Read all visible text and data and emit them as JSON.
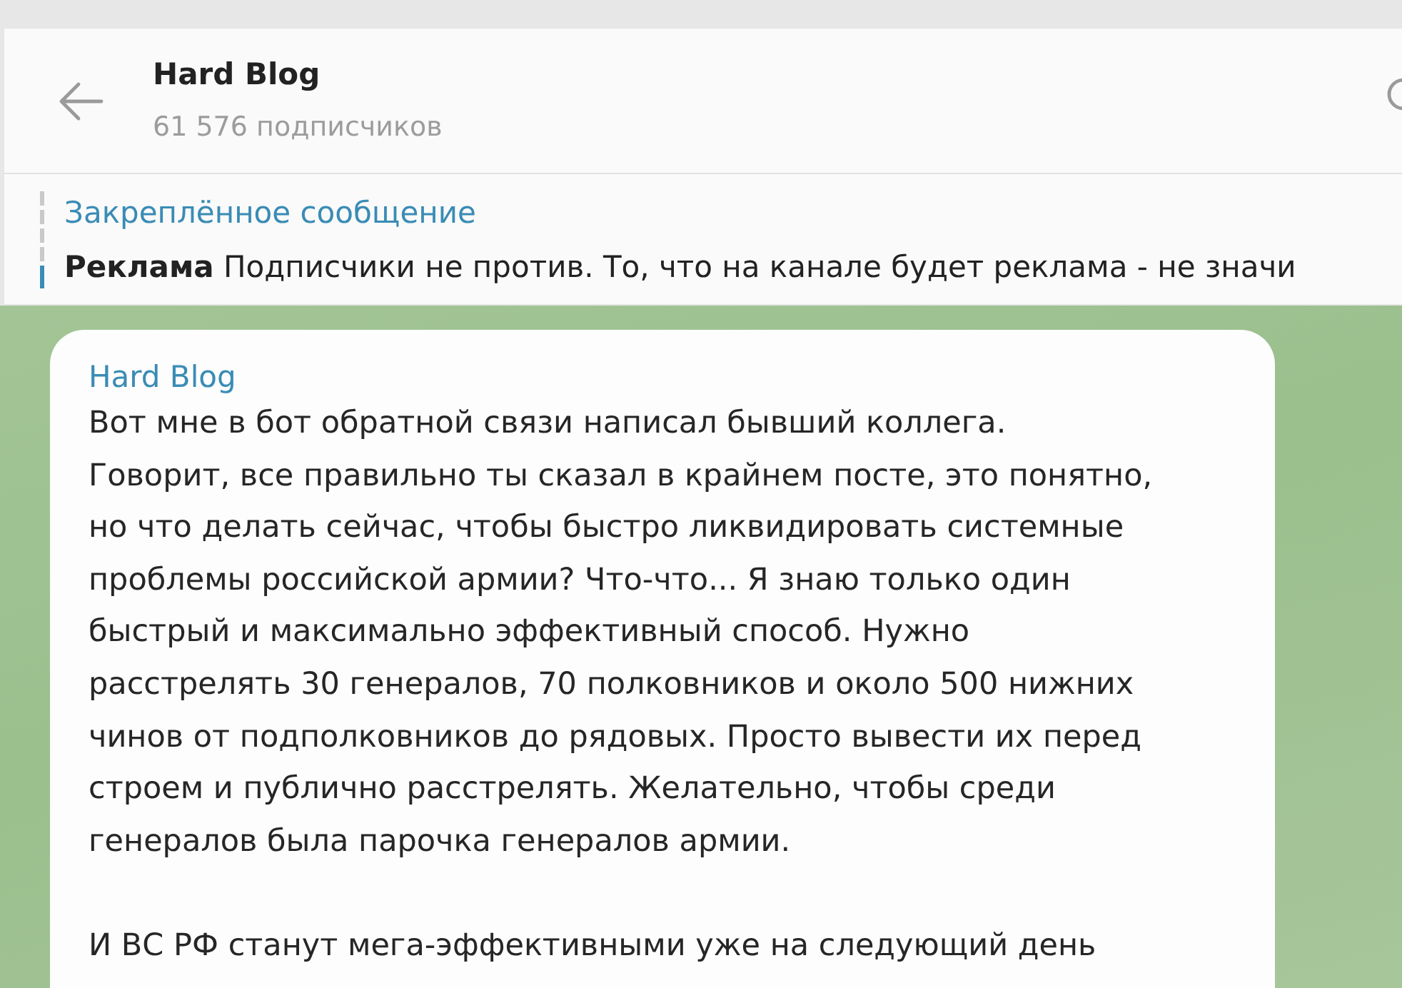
{
  "header": {
    "title": "Hard Blog",
    "subtitle": "61 576 подписчиков"
  },
  "pinned": {
    "label": "Закреплённое сообщение",
    "text": "**Реклама** Подписчики не против. То, что на канале будет реклама - не значи"
  },
  "message": {
    "author": "Hard Blog",
    "paragraphs": [
      "Вот мне в бот обратной связи написал бывший коллега.\nГоворит, все правильно ты сказал в крайнем посте, это понятно,\nно что делать сейчас, чтобы быстро ликвидировать системные\nпроблемы российской армии? Что-что... Я знаю только один\nбыстрый и максимально эффективный способ. Нужно\nрасстрелять 30 генералов, 70 полковников и около 500 нижних\nчинов от подполковников до рядовых. Просто вывести их перед\nстроем и публично расстрелять. Желательно, чтобы среди\nгенералов была парочка генералов армии.",
      "И ВС РФ станут мега-эффективными уже на следующий день"
    ]
  }
}
